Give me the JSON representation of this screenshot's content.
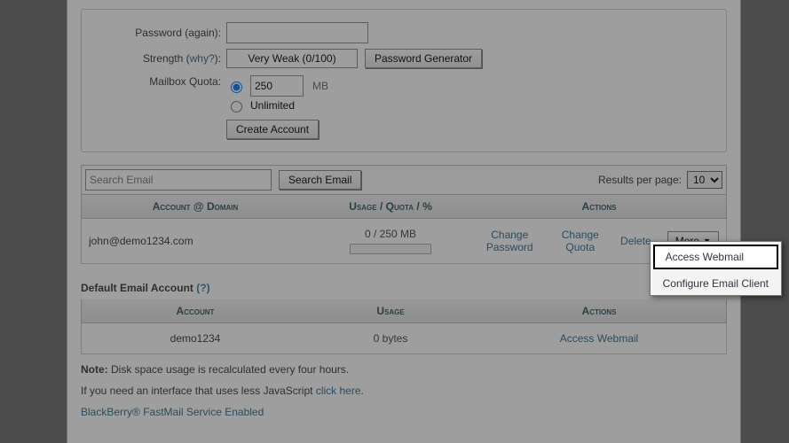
{
  "form": {
    "password_again_label": "Password (again):",
    "strength_label_pre": "Strength (",
    "strength_why": "why?",
    "strength_label_post": "):",
    "strength_value": "Very Weak (0/100)",
    "pw_gen_btn": "Password Generator",
    "quota_label": "Mailbox Quota:",
    "quota_value": "250",
    "quota_unit": "MB",
    "quota_unlimited": "Unlimited",
    "create_btn": "Create Account"
  },
  "search": {
    "placeholder": "Search Email",
    "btn": "Search Email",
    "per_page_label": "Results per page:",
    "per_page_value": "10"
  },
  "grid": {
    "h_account_pre": "Account",
    "h_account_at": " @ ",
    "h_account_post": "Domain",
    "h_usage_u": "Usage",
    "h_usage_q": "Quota",
    "h_usage_p": "%",
    "h_actions": "Actions",
    "row": {
      "email": "john@demo1234.com",
      "usage": "0 / 250 MB",
      "change_pw": "Change Password",
      "change_quota": "Change Quota",
      "delete": "Delete",
      "more": "More"
    }
  },
  "dropdown": {
    "access": "Access Webmail",
    "configure": "Configure Email Client"
  },
  "default_section": {
    "title": "Default Email Account",
    "q": "(?)",
    "h_account": "Account",
    "h_usage": "Usage",
    "h_actions": "Actions",
    "row": {
      "account": "demo1234",
      "usage": "0 bytes",
      "action": "Access Webmail"
    }
  },
  "footer": {
    "note_bold": "Note:",
    "note_rest": " Disk space usage is recalculated every four hours.",
    "js_line_pre": "If you need an interface that uses less JavaScript ",
    "js_link": "click here",
    "js_line_post": ".",
    "bb": "BlackBerry® FastMail Service Enabled"
  }
}
